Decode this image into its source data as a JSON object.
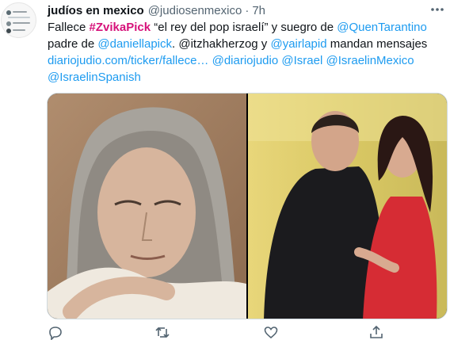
{
  "tweet": {
    "author_name": "judíos en mexico",
    "author_handle": "@judiosenmexico",
    "separator": "·",
    "time": "7h",
    "body": {
      "line1": {
        "t1": "Fallece ",
        "hashtag": "#ZvikaPick",
        "t2": " “el rey del pop israelí” y suegro de ",
        "mention1": "@QuenTarantino"
      },
      "line2": {
        "t1": "padre de ",
        "mention1": "@daniellapick",
        "t2": ". @itzhakherzog y ",
        "mention2": "@yairlapid",
        "t3": " mandan mensajes"
      },
      "line3": {
        "link": "diariojudio.com/ticker/fallece…",
        "mention1": "@diariojudio",
        "mention2": "@Israel",
        "mention3": "@IsraelinMexico"
      },
      "line4": {
        "mention1": "@IsraelinSpanish"
      }
    }
  },
  "colors": {
    "link": "#1d9bf0",
    "hashtag": "#d6127a",
    "text": "#0f1419",
    "secondary": "#536471"
  },
  "icons": [
    "more-icon",
    "reply-icon",
    "retweet-icon",
    "like-icon",
    "share-icon"
  ]
}
